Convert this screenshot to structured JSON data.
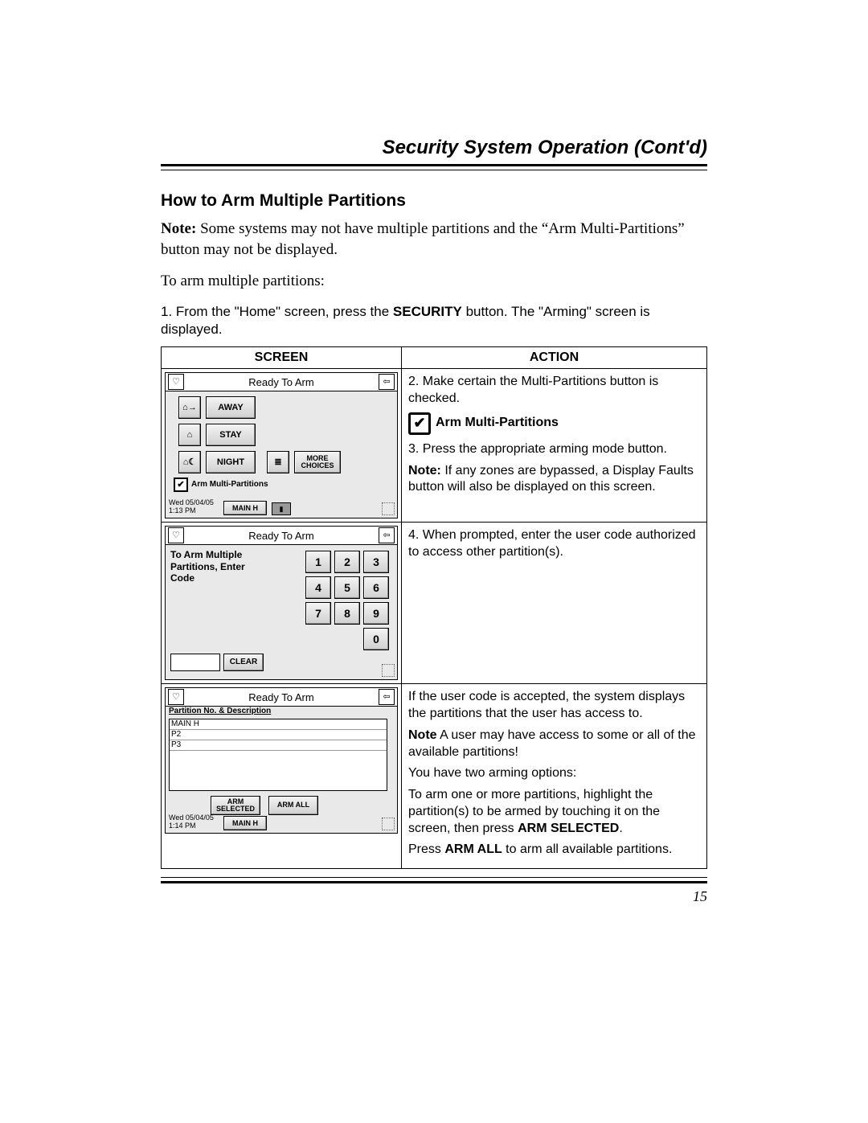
{
  "header": {
    "running_head": "Security System Operation (Cont'd)"
  },
  "section": {
    "title": "How to Arm Multiple Partitions",
    "note_label": "Note:",
    "note_body": " Some systems may not have multiple partitions and the “Arm Multi-Partitions” button may not be displayed.",
    "lead_in": "To arm multiple partitions:",
    "step1_pre": "1.  From the \"Home\" screen, press the ",
    "step1_bold": "SECURITY",
    "step1_post": " button.  The \"Arming\" screen is displayed."
  },
  "table": {
    "headers": {
      "screen": "SCREEN",
      "action": "ACTION"
    },
    "rows": [
      {
        "screen": {
          "title": "Ready To Arm",
          "buttons": {
            "away": "AWAY",
            "stay": "STAY",
            "night": "NIGHT",
            "more": "MORE CHOICES"
          },
          "arm_multi_label": "Arm Multi-Partitions",
          "timestamp_line1": "Wed 05/04/05",
          "timestamp_line2": "1:13 PM",
          "main_h": "MAIN H"
        },
        "action": {
          "p1": "2.  Make certain the Multi-Partitions button is checked.",
          "check_label": "Arm Multi-Partitions",
          "p2": "3.  Press the appropriate arming mode button.",
          "p3a": "Note:",
          "p3b": " If any zones are bypassed, a Display Faults button will also be displayed on this screen."
        }
      },
      {
        "screen": {
          "title": "Ready To Arm",
          "prompt": "To Arm Multiple Partitions, Enter Code",
          "keys": [
            "1",
            "2",
            "3",
            "4",
            "5",
            "6",
            "7",
            "8",
            "9",
            "0"
          ],
          "clear": "CLEAR"
        },
        "action": {
          "p1": "4.  When prompted, enter the user code authorized to access other partition(s)."
        }
      },
      {
        "screen": {
          "title": "Ready To Arm",
          "subhead": "Partition No. & Description",
          "partitions": [
            "MAIN H",
            "P2",
            "P3"
          ],
          "arm_selected": "ARM SELECTED",
          "arm_all": "ARM ALL",
          "timestamp_line1": "Wed 05/04/05",
          "timestamp_line2": "1:14 PM",
          "main_h": "MAIN H"
        },
        "action": {
          "p1": "If the user code is accepted, the system displays the partitions that the user has access to.",
          "p2a": "Note",
          "p2b": " A user may have access to some or all of the available partitions!",
          "p3": "You have two arming options:",
          "p4a": "To arm one or more partitions, highlight the partition(s) to be armed by touching it on the screen, then press ",
          "p4b": "ARM SELECTED",
          "p4c": ".",
          "p5a": "Press ",
          "p5b": "ARM ALL",
          "p5c": " to arm all available partitions."
        }
      }
    ]
  },
  "page_number": "15"
}
